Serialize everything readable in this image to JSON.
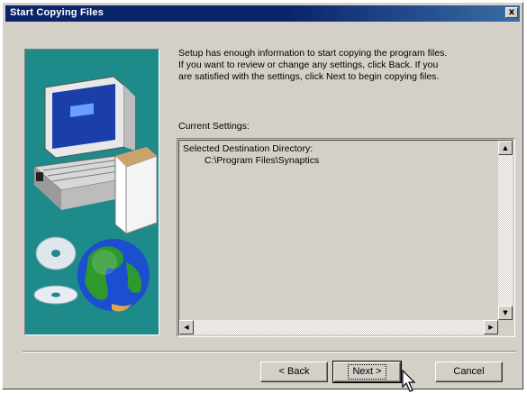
{
  "window": {
    "title": "Start Copying Files",
    "close_glyph": "x"
  },
  "intro": {
    "lines": [
      "Setup has enough information to start copying the program files.",
      "If you want to review or change any settings, click Back.  If you",
      "are satisfied with the settings, click Next to begin copying files."
    ]
  },
  "settings": {
    "label": "Current Settings:",
    "lines": [
      "Selected Destination Directory:",
      "C:\\Program Files\\Synaptics"
    ]
  },
  "buttons": {
    "back": "< Back",
    "next": "Next >",
    "cancel": "Cancel"
  },
  "scrollbar_glyphs": {
    "up": "▲",
    "down": "▼",
    "left": "◀",
    "right": "▶"
  },
  "icons": {
    "art": "computer-cd-globe-illustration",
    "pointer": "mouse-pointer-icon"
  }
}
